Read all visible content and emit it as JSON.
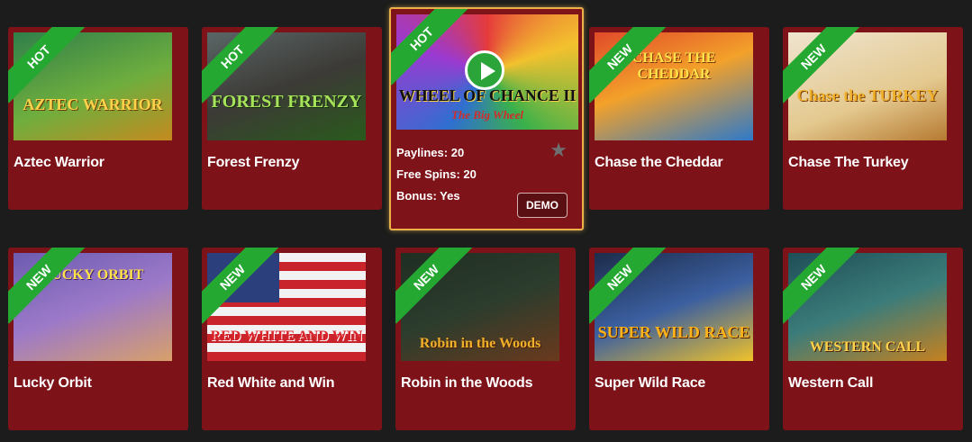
{
  "colors": {
    "card_bg": "#7d1319",
    "page_bg": "#1c1c1c",
    "hot_ribbon": "#25a832",
    "new_ribbon": "#25a832",
    "hover_border": "#e9b24a"
  },
  "games": [
    {
      "title": "Aztec Warrior",
      "badge": "HOT",
      "thumb_text": "AZTEC WARRIOR",
      "thumb_colors": [
        "#2f7f4a",
        "#c48a1f"
      ]
    },
    {
      "title": "Forest Frenzy",
      "badge": "HOT",
      "thumb_text": "FOREST FRENZY",
      "thumb_colors": [
        "#3c3a36",
        "#7bc24a"
      ]
    },
    {
      "title": "Wheel of Chance II",
      "badge": "HOT",
      "thumb_text": "WHEEL OF CHANCE II",
      "thumb_sub": "The Big Wheel",
      "thumb_colors": [
        "#1d1b3f",
        "#c43d3d"
      ],
      "details": {
        "paylines_label": "Paylines:",
        "paylines": "20",
        "free_spins_label": "Free Spins:",
        "free_spins": "20",
        "bonus_label": "Bonus:",
        "bonus": "Yes"
      },
      "demo_label": "DEMO"
    },
    {
      "title": "Chase the Cheddar",
      "badge": "NEW",
      "thumb_text": "CHASE THE CHEDDAR",
      "thumb_colors": [
        "#f3a12a",
        "#d64a2d"
      ]
    },
    {
      "title": "Chase The Turkey",
      "badge": "NEW",
      "thumb_text": "Chase the TURKEY",
      "thumb_colors": [
        "#e9dcc2",
        "#f0b12a"
      ]
    },
    {
      "title": "Lucky Orbit",
      "badge": "NEW",
      "thumb_text": "LUCKY ORBIT",
      "thumb_colors": [
        "#6c5bb0",
        "#d8a06a"
      ]
    },
    {
      "title": "Red White and Win",
      "badge": "NEW",
      "thumb_text": "RED WHITE AND WIN",
      "thumb_colors": [
        "#2b3f7d",
        "#c9242b"
      ]
    },
    {
      "title": "Robin in the Woods",
      "badge": "NEW",
      "thumb_text": "Robin in the Woods",
      "thumb_colors": [
        "#2c3c2d",
        "#b05f2a"
      ]
    },
    {
      "title": "Super Wild Race",
      "badge": "NEW",
      "thumb_text": "SUPER WILD RACE",
      "thumb_colors": [
        "#1d2c4a",
        "#f0c22a"
      ]
    },
    {
      "title": "Western Call",
      "badge": "NEW",
      "thumb_text": "WESTERN CALL",
      "thumb_colors": [
        "#1f4e57",
        "#c6811f"
      ]
    }
  ]
}
